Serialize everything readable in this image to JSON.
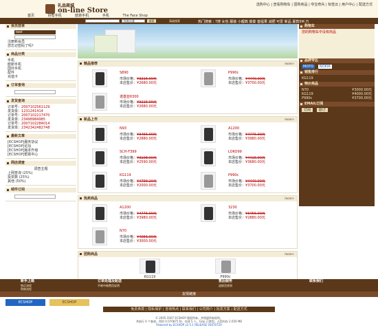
{
  "header": {
    "logo_cn": "礼品商城",
    "logo_en": "on-line Store",
    "top_links": "选购中心 | 查看购物车 | 团购商品 | 夺宝奇兵 | 标签云 | 用户中心 | 配送方式",
    "nav": [
      "首页",
      "好帮手机",
      "欧斯手机",
      "手机",
      "The Face Shop"
    ]
  },
  "search": {
    "select": "所有分类",
    "button": "搜索",
    "hot_label": "高级搜索",
    "hot_links": "热门搜索 : 7搜 女包 服装 小靓典 葵葵 菩提果 减肥 可爱 新品 夏款5M 万"
  },
  "left": {
    "login_title": "会员登录",
    "user_label": "test",
    "login_links": [
      "注册新会员",
      "您忘记密码了吗?"
    ],
    "cat_title": "商品分类",
    "cats": [
      "手机",
      "欧斯手机",
      "国外手机",
      "配件",
      "充值卡"
    ],
    "order_title": "订单查询",
    "invoice_title": "发货查询",
    "invoice_rows": [
      [
        "订单号：",
        "2007102561129"
      ],
      [
        "发货单：",
        "1231241414"
      ],
      [
        "订单号：",
        "2007102217470"
      ],
      [
        "发货单：",
        "23498984985"
      ],
      [
        "订单号：",
        "2007102284014"
      ],
      [
        "发货单：",
        "2342342482748"
      ]
    ],
    "news_title": "最新文章",
    "news": [
      "[ECSHOP]服务协议",
      "[ECSHOP]论坛",
      "[ECSHOP]版本升级",
      "[ECSHOP]帮助中心"
    ],
    "vote_title": "网店调查",
    "vote_q": "调查主题",
    "vote_opts": [
      "上网查询 (25%)",
      "投票数 (25%)",
      "其他 (50%)"
    ],
    "email_title": "邮件订阅"
  },
  "right": {
    "cart_title": "购物车",
    "cart_text": "您的购物车中没有商品",
    "brand_title": "品牌专区",
    "brands": [
      "MOTO",
      "NOKIA"
    ],
    "sale_title": "销售排行",
    "sale_rows": [
      "KG119"
    ],
    "special_title": "特价商品",
    "special_rows": [
      [
        "N70",
        "¥3000.00元"
      ],
      [
        "KG119",
        "¥4000.00元"
      ],
      [
        "P990c",
        "¥3700.00元"
      ]
    ],
    "email_title": "EMAIL订阅",
    "email_btns": [
      "订阅",
      "退订"
    ]
  },
  "center": {
    "best_title": "精品推荐",
    "new_title": "新品上市",
    "hot_title": "热卖商品",
    "group_title": "团购商品",
    "more": "more>",
    "price_market": "市场价格：",
    "price_shop": "本店售价：",
    "best": [
      {
        "name": "S890",
        "p1": "¥3216.00元",
        "p2": "¥2680.00元",
        "silver": false
      },
      {
        "name": "P990c",
        "p1": "¥4440.00元",
        "p2": "¥3700.00元",
        "silver": true
      },
      {
        "name": "诺基亚6300",
        "p1": "¥3216.00元",
        "p2": "¥2680.00元",
        "silver": true
      }
    ],
    "new": [
      {
        "name": "N93",
        "p1": "¥3456.00元",
        "p2": "¥2880.00元",
        "silver": false
      },
      {
        "name": "A1200",
        "p1": "¥4776.00元",
        "p2": "¥3980.00元",
        "silver": false
      },
      {
        "name": "SCH-F399",
        "p1": "¥3108.00元",
        "p2": "¥2590.00元",
        "silver": false
      },
      {
        "name": "LOKO99",
        "p1": "¥4416.00元",
        "p2": "¥3680.00元",
        "silver": false
      },
      {
        "name": "KG119",
        "p1": "¥4799.20元",
        "p2": "¥2000.00元",
        "silver": false
      },
      {
        "name": "P990c",
        "p1": "¥4440.00元",
        "p2": "¥3700.00元",
        "silver": true
      }
    ],
    "hot": [
      {
        "name": "A1200",
        "p1": "¥4776.00元",
        "p2": "¥3980.00元",
        "silver": false
      },
      {
        "name": "3230",
        "p1": "¥3456.00元",
        "p2": "¥2880.00元",
        "silver": false
      },
      {
        "name": "N70",
        "p1": "¥4056.00元",
        "p2": "¥3000.00元",
        "silver": true
      }
    ],
    "group": [
      {
        "name": "KG119",
        "price": "¥4000.00元",
        "silver": false
      },
      {
        "name": "P990c",
        "price": "¥1800.00元",
        "silver": true
      }
    ]
  },
  "footer": {
    "cols": [
      {
        "t": "新手上路",
        "l": [
          "售后流程",
          "购物流程"
        ]
      },
      {
        "t": "订单处理及配送",
        "l": [
          "平邮中邮费用说明"
        ]
      },
      {
        "t": "售后服务",
        "l": [
          "退换货原则"
        ]
      },
      {
        "t": "联系我们",
        "l": []
      }
    ],
    "friend": "友情链接",
    "ad1": "ECSHOP",
    "ad2": "ECSHOP",
    "bottom": "免责条款 | 隐私保护 | 咨询热点 | 联系我们 | 公司简介 | 批发方案 | 配送方式",
    "copy1": "© 2005-2007 ECSHOP 版权所有，并保留所有权利。",
    "copy2": "共执行 6 个查询，用时 0.070875 秒，在线 5 人，Gzip 已禁用，占用内存 2.659 MB",
    "copy3": "Powered by ECSHOP v2.5.1 RELEASE 20070720"
  }
}
